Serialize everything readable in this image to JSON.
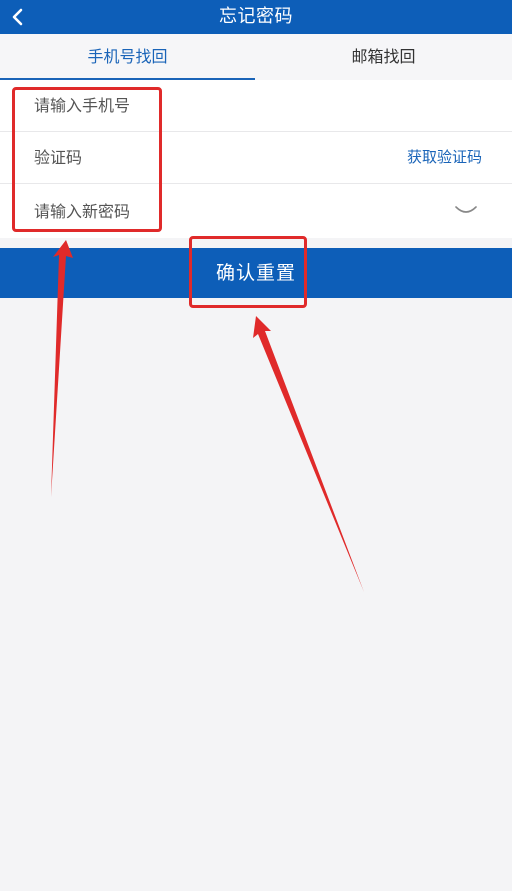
{
  "header": {
    "title": "忘记密码",
    "back_icon": "chevron-left-icon"
  },
  "tabs": [
    {
      "label": "手机号找回",
      "active": true
    },
    {
      "label": "邮箱找回",
      "active": false
    }
  ],
  "form": {
    "phone_placeholder": "请输入手机号",
    "code_placeholder": "验证码",
    "get_code_label": "获取验证码",
    "password_placeholder": "请输入新密码",
    "password_toggle_icon": "eye-closed-icon"
  },
  "confirm_button": {
    "label": "确认重置"
  },
  "colors": {
    "primary": "#0d5eb8",
    "link": "#1a64b8",
    "annotation": "#e02a2a",
    "background": "#f4f4f6"
  }
}
